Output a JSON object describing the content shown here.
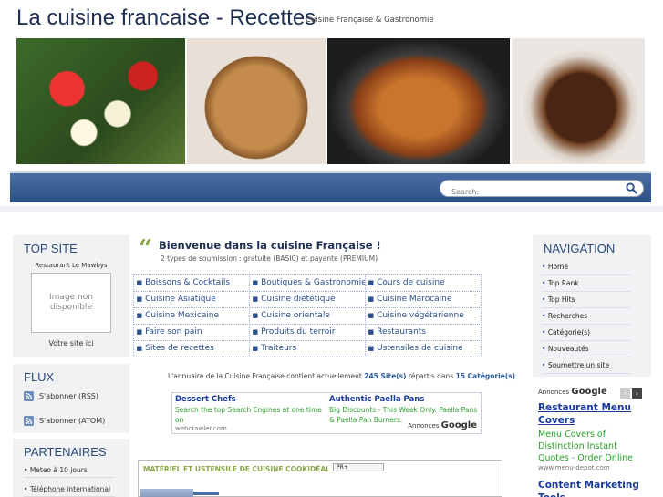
{
  "header": {
    "title": "La cuisine francaise - Recettes",
    "subtitle": "Cuisine Française & Gastronomie"
  },
  "search": {
    "placeholder": "Search:"
  },
  "top_site": {
    "heading": "TOP SITE",
    "restaurant": "Restaurant Le Mawbys",
    "image_placeholder": "Image non disponible",
    "your_site": "Votre site ici"
  },
  "flux": {
    "heading": "FLUX",
    "items": [
      {
        "label": "S'abonner (RSS)"
      },
      {
        "label": "S'abonner (ATOM)"
      }
    ]
  },
  "partners": {
    "heading": "PARTENAIRES",
    "items": [
      {
        "label": "Meteo à 10 jours"
      },
      {
        "label": "Téléphone international"
      }
    ]
  },
  "navigation": {
    "heading": "NAVIGATION",
    "items": [
      {
        "label": "Home"
      },
      {
        "label": "Top Rank"
      },
      {
        "label": "Top Hits"
      },
      {
        "label": "Recherches"
      },
      {
        "label": "Catégorie(s)"
      },
      {
        "label": "Nouveautés"
      },
      {
        "label": "Soumettre un site"
      }
    ]
  },
  "welcome": {
    "title": "Bienvenue dans la cuisine Française !",
    "subtitle": "2 types de soumission : gratuite (BASIC) et payante (PREMIUM)"
  },
  "categories": [
    "Boissons & Cocktails",
    "Boutiques & Gastronomie",
    "Cours de cuisine",
    "Cuisine Asiatique",
    "Cuisine diététique",
    "Cuisine Marocaine",
    "Cuisine Mexicaine",
    "Cuisine orientale",
    "Cuisine végétarienne",
    "Faire son pain",
    "Produits du terroir",
    "Restaurants",
    "Sites de recettes",
    "Traiteurs",
    "Ustensiles de cuisine"
  ],
  "stats": {
    "prefix": "L'annuaire de la Cuisine Française contient actuellement",
    "sites": "245 Site(s)",
    "middle": "répartis dans",
    "cats": "15 Catégorie(s)"
  },
  "ads": [
    {
      "title": "Dessert Chefs",
      "desc": "Search the top Search Engines at one time on",
      "url": "webcrawler.com"
    },
    {
      "title": "Authentic Paella Pans",
      "desc": "Big Discounts - This Week Only. Paella Pans & Paella Pan Burners.",
      "url": ""
    }
  ],
  "google_badge": {
    "prefix": "Annonces",
    "brand": "Google"
  },
  "featured_box": {
    "title": "MATÉRIEL ET USTENSILE DE CUISINE COOKIDÉAL",
    "pr_label": "PR+"
  },
  "right_ads": {
    "items": [
      {
        "title": "Restaurant Menu Covers",
        "desc": "Menu Covers of Distinction Instant Quotes - Order Online",
        "url": "www.menu-depot.com"
      },
      {
        "title": "Content Marketing Tools",
        "desc": "",
        "url": ""
      }
    ]
  },
  "colors": {
    "brand": "#1e2f52",
    "nav": "#2c4f86",
    "accent": "#8aa84a",
    "link": "#2a4f8a",
    "ad_desc": "#2aa02a"
  }
}
